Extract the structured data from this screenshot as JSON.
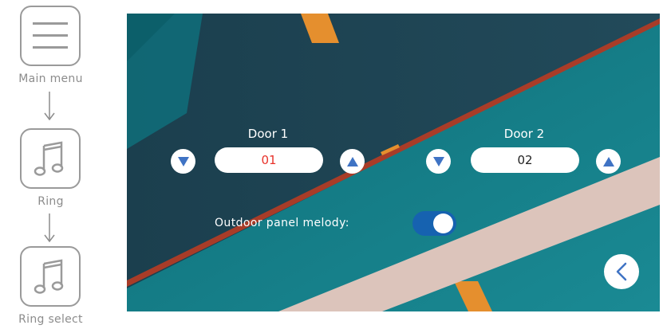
{
  "nav": {
    "steps": [
      {
        "label": "Main menu",
        "icon": "hamburger-icon"
      },
      {
        "label": "Ring",
        "icon": "music-note-icon"
      },
      {
        "label": "Ring select",
        "icon": "music-note-icon"
      }
    ]
  },
  "screen": {
    "door1": {
      "title": "Door 1",
      "value": "01",
      "value_color": "#e8322a"
    },
    "door2": {
      "title": "Door 2",
      "value": "02",
      "value_color": "#222222"
    },
    "melody": {
      "label": "Outdoor panel melody:",
      "enabled": true
    },
    "colors": {
      "accent": "#1662b0",
      "arrow": "#3f73c4"
    }
  }
}
